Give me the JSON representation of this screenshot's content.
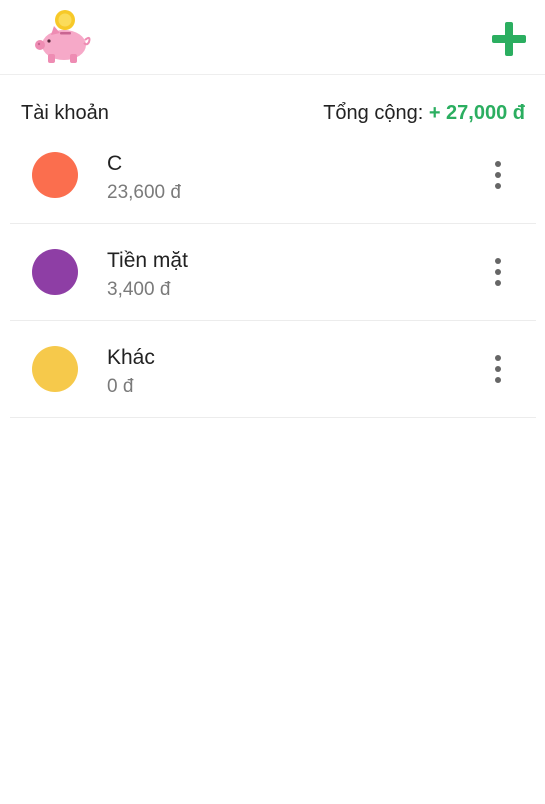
{
  "header": {
    "logo_icon": "piggy-bank-icon",
    "add_icon": "plus-icon",
    "add_color": "#2bae60"
  },
  "summary": {
    "title": "Tài khoản",
    "total_label": "Tổng cộng: ",
    "total_value": "+ 27,000 đ",
    "total_color": "#2bae60"
  },
  "accounts": [
    {
      "name": "C",
      "balance": "23,600 đ",
      "color": "#fb6e4e",
      "menu_icon": "more-vertical-icon"
    },
    {
      "name": "Tiền mặt",
      "balance": "3,400 đ",
      "color": "#8e3ea5",
      "menu_icon": "more-vertical-icon"
    },
    {
      "name": "Khác",
      "balance": "0 đ",
      "color": "#f6c94b",
      "menu_icon": "more-vertical-icon"
    }
  ]
}
